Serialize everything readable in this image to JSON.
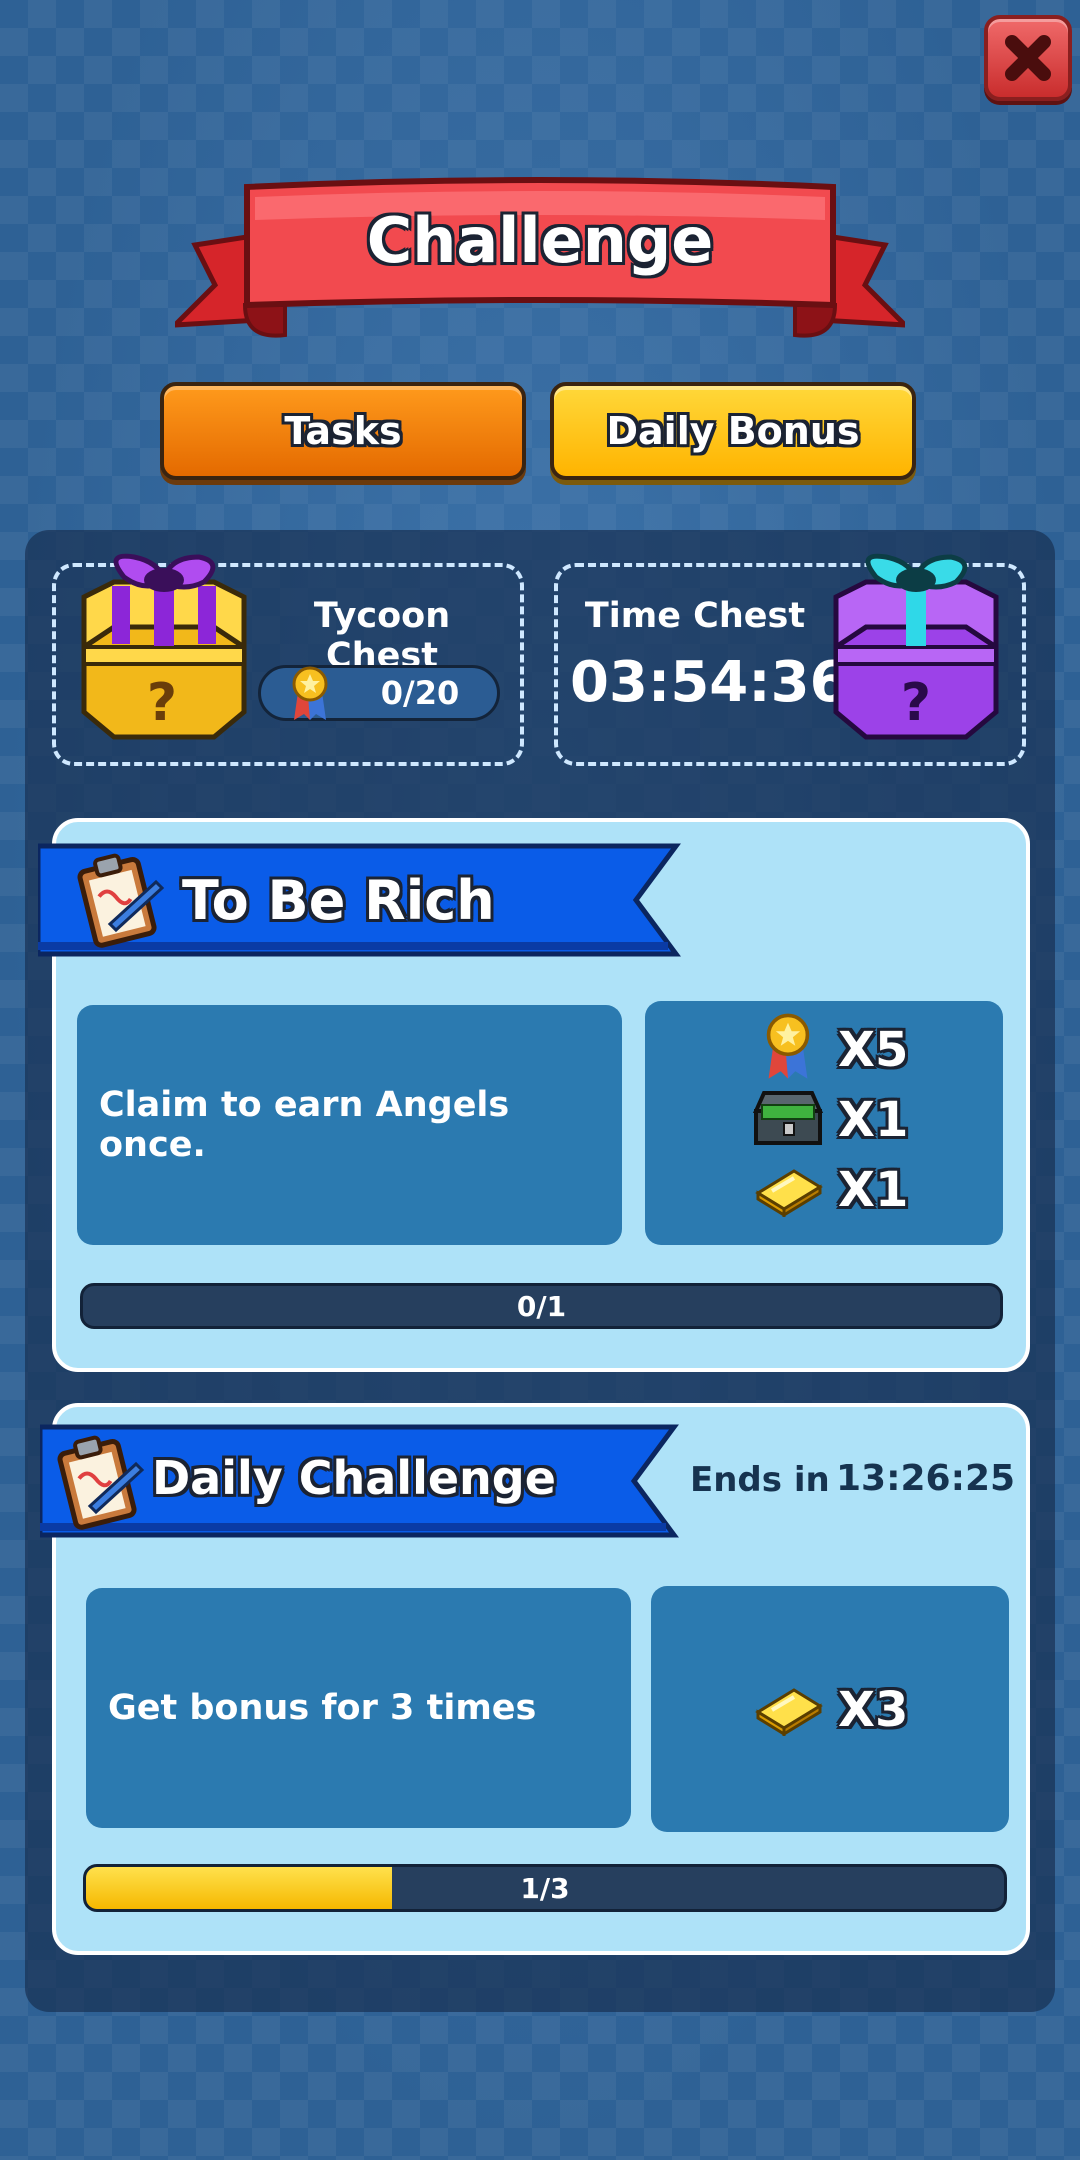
{
  "header": {
    "title": "Challenge",
    "close_icon": "close-icon"
  },
  "tabs": [
    {
      "label": "Tasks",
      "color": "#f08000"
    },
    {
      "label": "Daily Bonus",
      "color": "#ffc21a"
    }
  ],
  "chests": {
    "tycoon": {
      "title": "Tycoon Chest",
      "progress": "0/20",
      "icon": "medal-icon"
    },
    "time": {
      "title": "Time Chest",
      "countdown": "03:54:36"
    }
  },
  "task": {
    "title": "To Be Rich",
    "description": "Claim to earn Angels once.",
    "rewards": [
      {
        "icon": "medal-icon",
        "qty": "X5"
      },
      {
        "icon": "cash-chest-icon",
        "qty": "X1"
      },
      {
        "icon": "gold-bar-icon",
        "qty": "X1"
      }
    ],
    "progress_text": "0/1",
    "progress_fraction": 0
  },
  "daily": {
    "title": "Daily Challenge",
    "ends_label": "Ends in",
    "ends_time": "13:26:25",
    "description": "Get bonus for 3 times",
    "rewards": [
      {
        "icon": "gold-bar-icon",
        "qty": "X3"
      }
    ],
    "progress_text": "1/3",
    "progress_fraction": 0.333
  },
  "colors": {
    "accent_blue": "#0a5ce8",
    "card_bg": "#aee2f8",
    "progress_yellow": "#ffd024"
  }
}
